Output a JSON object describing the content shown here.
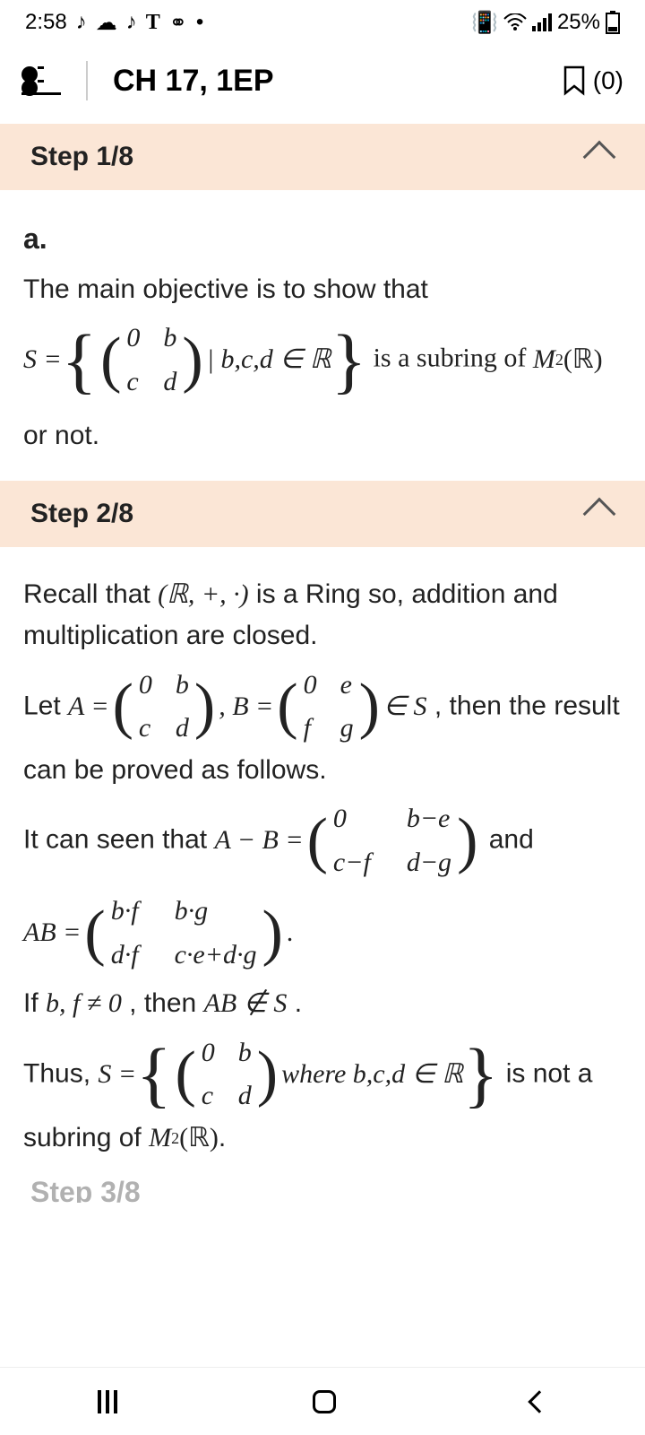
{
  "status": {
    "time": "2:58",
    "battery": "25%"
  },
  "header": {
    "title": "CH 17, 1EP",
    "bookmark_count": "(0)"
  },
  "steps": {
    "s1": {
      "label": "Step 1/8"
    },
    "s2": {
      "label": "Step 2/8"
    },
    "s3": {
      "label": "Step 3/8"
    }
  },
  "part_label": "a.",
  "s1_text": {
    "intro": "The main objective is to show that",
    "S_eq": "S =",
    "mat": {
      "a": "0",
      "b": "b",
      "c": "c",
      "d": "d"
    },
    "cond": "| b,c,d ∈ ℝ",
    "tail1": " is a subring of ",
    "m2r": "M",
    "m2sub": "2",
    "m2arg": "(ℝ)",
    "ornot": "or not."
  },
  "s2_text": {
    "recall_a": "Recall that ",
    "ring": "(ℝ, +, ·)",
    "recall_b": " is a Ring so, addition and multiplication are closed.",
    "let": "Let ",
    "Aeq": "A =",
    "Beq": ", B =",
    "matA": {
      "a": "0",
      "b": "b",
      "c": "c",
      "d": "d"
    },
    "matB": {
      "a": "0",
      "b": "e",
      "c": "f",
      "d": "g"
    },
    "inS": "∈ S",
    "thenres": " , then the result can be proved as follows.",
    "seen": "It can seen that ",
    "AmB": "A − B =",
    "matAmB": {
      "a": "0",
      "b": "b−e",
      "c": "c−f",
      "d": "d−g"
    },
    "and": " and",
    "ABeq": "AB =",
    "matAB": {
      "a": "b·f",
      "b": "b·g",
      "c": "d·f",
      "d": "c·e+d·g"
    },
    "dot": ".",
    "if_a": "If ",
    "bf": "b, f ≠ 0",
    "if_b": ", then ",
    "abnotin": "AB ∉ S",
    "if_c": ".",
    "thus": "Thus, ",
    "Seq2": "S =",
    "matS2": {
      "a": "0",
      "b": "b",
      "c": "c",
      "d": "d"
    },
    "where": " where b,c,d ∈ ℝ",
    "isnot": " is not a subring of ",
    "m2r": "M",
    "m2sub": "2",
    "m2arg": "(ℝ)",
    "dot2": "."
  }
}
